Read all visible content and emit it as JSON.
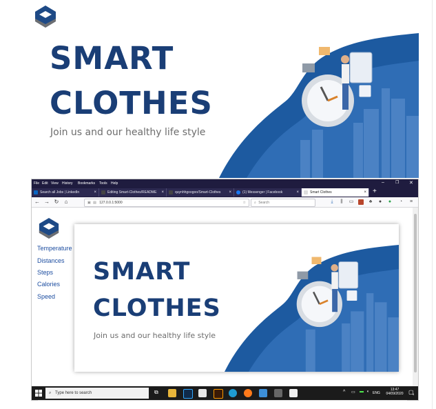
{
  "hero": {
    "title_line1": "SMART",
    "title_line2": "CLOTHES",
    "subtitle": "Join us and our healthy life style"
  },
  "browser": {
    "menu": [
      "File",
      "Edit",
      "View",
      "History",
      "Bookmarks",
      "Tools",
      "Help"
    ],
    "tabs": [
      {
        "label": "Search all Jobs | LinkedIn",
        "icon": "linkedin-icon",
        "color": "#0a66c2",
        "active": false
      },
      {
        "label": "Editing Smart-Clothes/README",
        "icon": "github-icon",
        "color": "#444444",
        "active": false
      },
      {
        "label": "quynhhgoogoo/Smart-Clothes",
        "icon": "github-icon",
        "color": "#444444",
        "active": false
      },
      {
        "label": "(1) Messenger | Facebook",
        "icon": "facebook-icon",
        "color": "#1877f2",
        "active": false
      },
      {
        "label": "Smart Clothes",
        "icon": "page-icon",
        "color": "#cccccc",
        "active": true
      }
    ],
    "url": "127.0.0.1:5000",
    "search_placeholder": "Search",
    "sidebar": [
      "Temperature",
      "Distances",
      "Steps",
      "Calories",
      "Speed"
    ],
    "card": {
      "title_line1": "SMART",
      "title_line2": "CLOTHES",
      "subtitle": "Join us and our healthy life style"
    },
    "taskbar": {
      "search_placeholder": "Type here to search",
      "language": "ENG",
      "time": "13:47",
      "date": "04/09/2020",
      "notification_count": "4"
    }
  },
  "colors": {
    "brand_navy": "#1a3e76",
    "brand_blue": "#2f6db5",
    "link_blue": "#1c4da0",
    "titlebar": "#1f1c3f"
  }
}
